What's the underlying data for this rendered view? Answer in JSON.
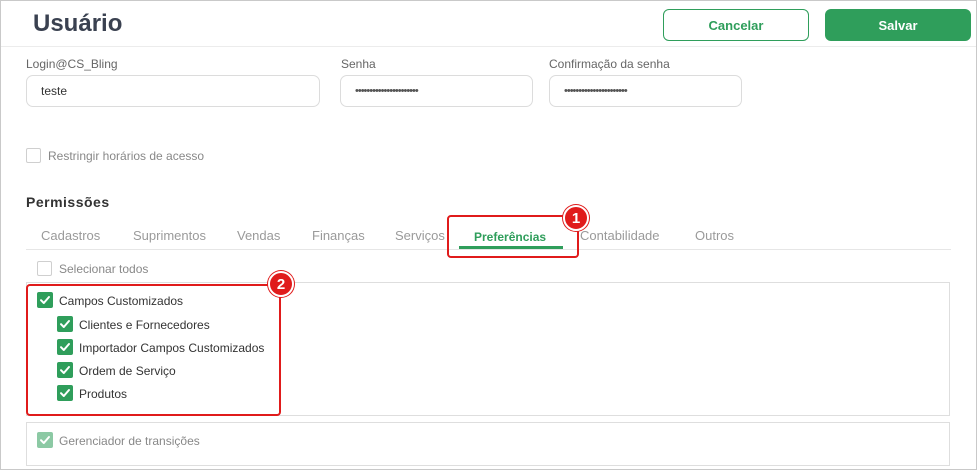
{
  "header": {
    "title": "Usuário",
    "cancel_label": "Cancelar",
    "save_label": "Salvar"
  },
  "form": {
    "login_label": "Login@CS_Bling",
    "login_value": "teste",
    "password_label": "Senha",
    "password_value": "••••••••••••••••••••••",
    "confirm_label": "Confirmação da senha",
    "confirm_value": "••••••••••••••••••••••",
    "restrict_label": "Restringir horários de acesso",
    "restrict_checked": false
  },
  "permissions": {
    "title": "Permissões",
    "tabs": [
      {
        "label": "Cadastros"
      },
      {
        "label": "Suprimentos"
      },
      {
        "label": "Vendas"
      },
      {
        "label": "Finanças"
      },
      {
        "label": "Serviços"
      },
      {
        "label": "Preferências",
        "active": true
      },
      {
        "label": "Contabilidade"
      },
      {
        "label": "Outros"
      }
    ],
    "select_all_label": "Selecionar todos",
    "groups": [
      {
        "label": "Campos Customizados",
        "checked": true,
        "children": [
          {
            "label": "Clientes e Fornecedores",
            "checked": true
          },
          {
            "label": "Importador Campos Customizados",
            "checked": true
          },
          {
            "label": "Ordem de Serviço",
            "checked": true
          },
          {
            "label": "Produtos",
            "checked": true
          }
        ]
      },
      {
        "label": "Gerenciador de transições",
        "checked": true,
        "children": []
      }
    ]
  },
  "annotations": {
    "badge_1": "1",
    "badge_2": "2",
    "highlight_color": "#e01b1b"
  },
  "colors": {
    "accent": "#2f9e5b",
    "title": "#3a4150"
  }
}
